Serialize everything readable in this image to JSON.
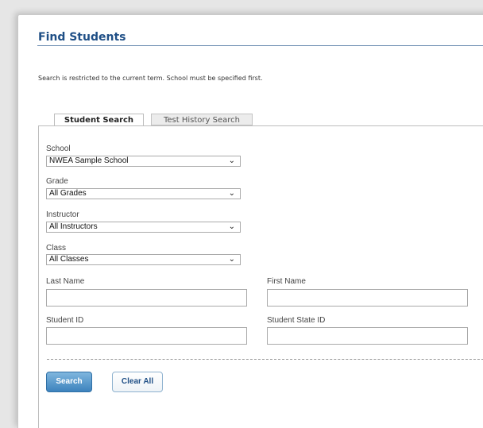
{
  "page": {
    "title": "Find Students",
    "info": "Search is restricted to the current term. School must be specified first."
  },
  "tabs": [
    {
      "label": "Student Search",
      "active": true
    },
    {
      "label": "Test History Search",
      "active": false
    }
  ],
  "form": {
    "school": {
      "label": "School",
      "value": "NWEA Sample School"
    },
    "grade": {
      "label": "Grade",
      "value": "All Grades"
    },
    "instructor": {
      "label": "Instructor",
      "value": "All Instructors"
    },
    "class": {
      "label": "Class",
      "value": "All Classes"
    },
    "last_name": {
      "label": "Last Name",
      "value": ""
    },
    "first_name": {
      "label": "First Name",
      "value": ""
    },
    "student_id": {
      "label": "Student ID",
      "value": ""
    },
    "student_state_id": {
      "label": "Student State ID",
      "value": ""
    }
  },
  "buttons": {
    "search": "Search",
    "clear_all": "Clear All"
  },
  "icons": {
    "dropdown": "chevron-down-icon"
  },
  "colors": {
    "title": "#1f4f86",
    "primary_button": "#3d83bd"
  }
}
